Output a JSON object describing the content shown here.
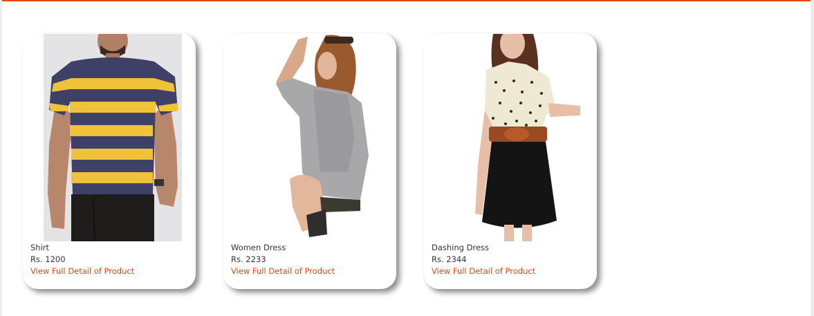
{
  "theme": {
    "accent_color": "#e8470f",
    "card_background": "#ffffff",
    "page_background": "#ffffff"
  },
  "products": [
    {
      "name": "Shirt",
      "price": "Rs. 1200",
      "link_label": "View Full Detail of Product",
      "image": "man-in-striped-tshirt"
    },
    {
      "name": "Women Dress",
      "price": "Rs. 2233",
      "link_label": "View Full Detail of Product",
      "image": "woman-in-grey-top"
    },
    {
      "name": "Dashing Dress",
      "price": "Rs. 2344",
      "link_label": "View Full Detail of Product",
      "image": "woman-in-polka-dot-dress"
    }
  ]
}
